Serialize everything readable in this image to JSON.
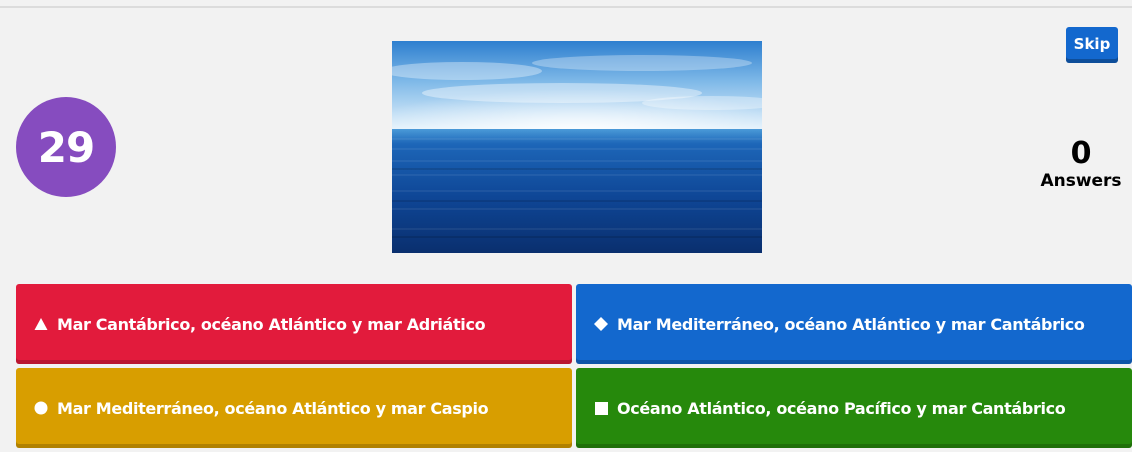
{
  "timer": {
    "value": "29"
  },
  "skip": {
    "label": "Skip"
  },
  "answers": {
    "count": "0",
    "label": "Answers"
  },
  "media": {
    "description": ""
  },
  "colors": {
    "timer": "#864cbf",
    "skip": "#1368ce",
    "red": "#e21b3c",
    "blue": "#1368ce",
    "yellow": "#d89e00",
    "green": "#26890c"
  },
  "options": [
    {
      "shape": "triangle-icon",
      "text": "Mar Cantábrico, océano Atlántico y mar Adriático"
    },
    {
      "shape": "diamond-icon",
      "text": "Mar Mediterráneo, océano Atlántico y mar Cantábrico"
    },
    {
      "shape": "circle-icon",
      "text": "Mar Mediterráneo, océano Atlántico y mar Caspio"
    },
    {
      "shape": "square-icon",
      "text": "Océano Atlántico, océano Pacífico y mar Cantábrico"
    }
  ]
}
